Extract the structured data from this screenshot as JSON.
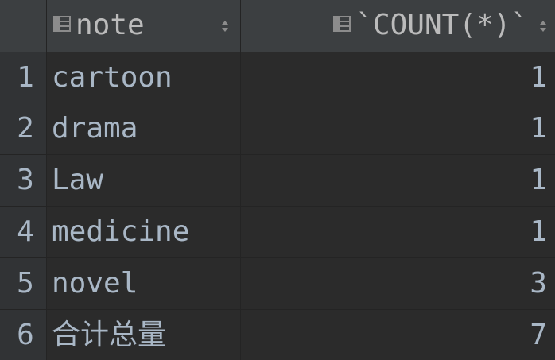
{
  "table": {
    "columns": [
      {
        "label": "note",
        "icon": "column-icon"
      },
      {
        "label": "`COUNT(*)`",
        "icon": "column-icon"
      }
    ],
    "rows": [
      {
        "num": "1",
        "note": "cartoon",
        "count": "1"
      },
      {
        "num": "2",
        "note": "drama",
        "count": "1"
      },
      {
        "num": "3",
        "note": "Law",
        "count": "1"
      },
      {
        "num": "4",
        "note": "medicine",
        "count": "1"
      },
      {
        "num": "5",
        "note": "novel",
        "count": "3"
      },
      {
        "num": "6",
        "note": "合计总量",
        "count": "7"
      }
    ]
  },
  "colors": {
    "background": "#2b2b2b",
    "header": "#3c3f41",
    "text": "#a9b7c6"
  }
}
